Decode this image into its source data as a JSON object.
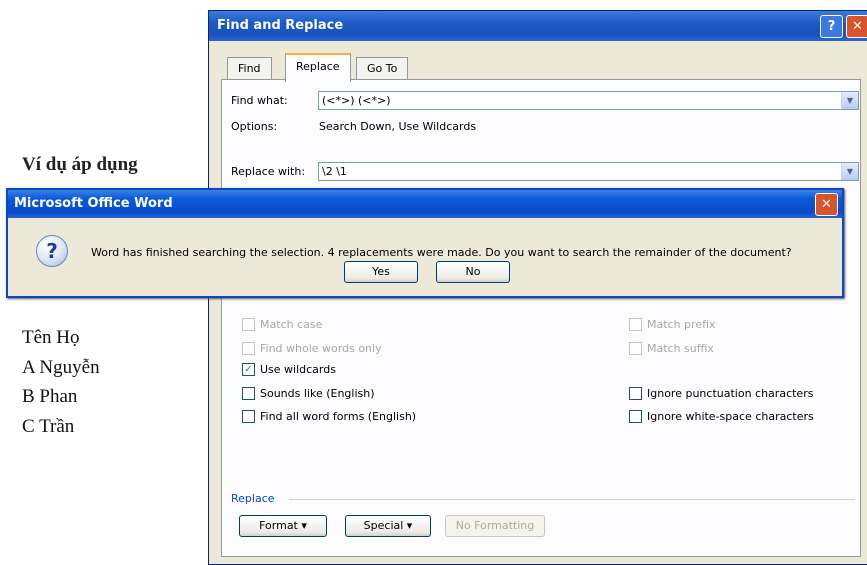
{
  "document": {
    "partial_heading": "Ví dụ áp dụng",
    "lines": [
      "Tên Họ",
      "A Nguyễn",
      "B Phan",
      "C Trần"
    ]
  },
  "find_replace": {
    "title": "Find and Replace",
    "help_glyph": "?",
    "close_glyph": "✕",
    "tabs": [
      "Find",
      "Replace",
      "Go To"
    ],
    "active_tab": "Replace",
    "find_what_label": "Find what:",
    "find_what_value": "(<*>) (<*>)",
    "options_label": "Options:",
    "options_value": "Search Down, Use Wildcards",
    "replace_with_label": "Replace with:",
    "replace_with_value": "\\2 \\1",
    "options": {
      "match_case": {
        "label": "Match case",
        "checked": false,
        "disabled": true
      },
      "find_whole_words": {
        "label": "Find whole words only",
        "checked": false,
        "disabled": true
      },
      "use_wildcards": {
        "label": "Use wildcards",
        "checked": true
      },
      "sounds_like": {
        "label": "Sounds like (English)",
        "checked": false
      },
      "find_all_word_forms": {
        "label": "Find all word forms (English)",
        "checked": false
      },
      "match_prefix": {
        "label": "Match prefix",
        "checked": false,
        "disabled": true
      },
      "match_suffix": {
        "label": "Match suffix",
        "checked": false,
        "disabled": true
      },
      "ignore_punctuation": {
        "label": "Ignore punctuation characters",
        "checked": false
      },
      "ignore_whitespace": {
        "label": "Ignore white-space characters",
        "checked": false
      }
    },
    "replace_section_label": "Replace",
    "format_button": "Format ▾",
    "special_button": "Special ▾",
    "no_formatting_button": "No Formatting"
  },
  "message_box": {
    "title": "Microsoft Office Word",
    "close_glyph": "✕",
    "icon_glyph": "?",
    "message": "Word has finished searching the selection.  4 replacements were made.  Do you want to search the remainder of the document?",
    "yes_button": "Yes",
    "no_button": "No"
  },
  "colors": {
    "title_bar": "#1c59c8",
    "dialog_face": "#ece9d8",
    "close_button": "#d9532c"
  }
}
